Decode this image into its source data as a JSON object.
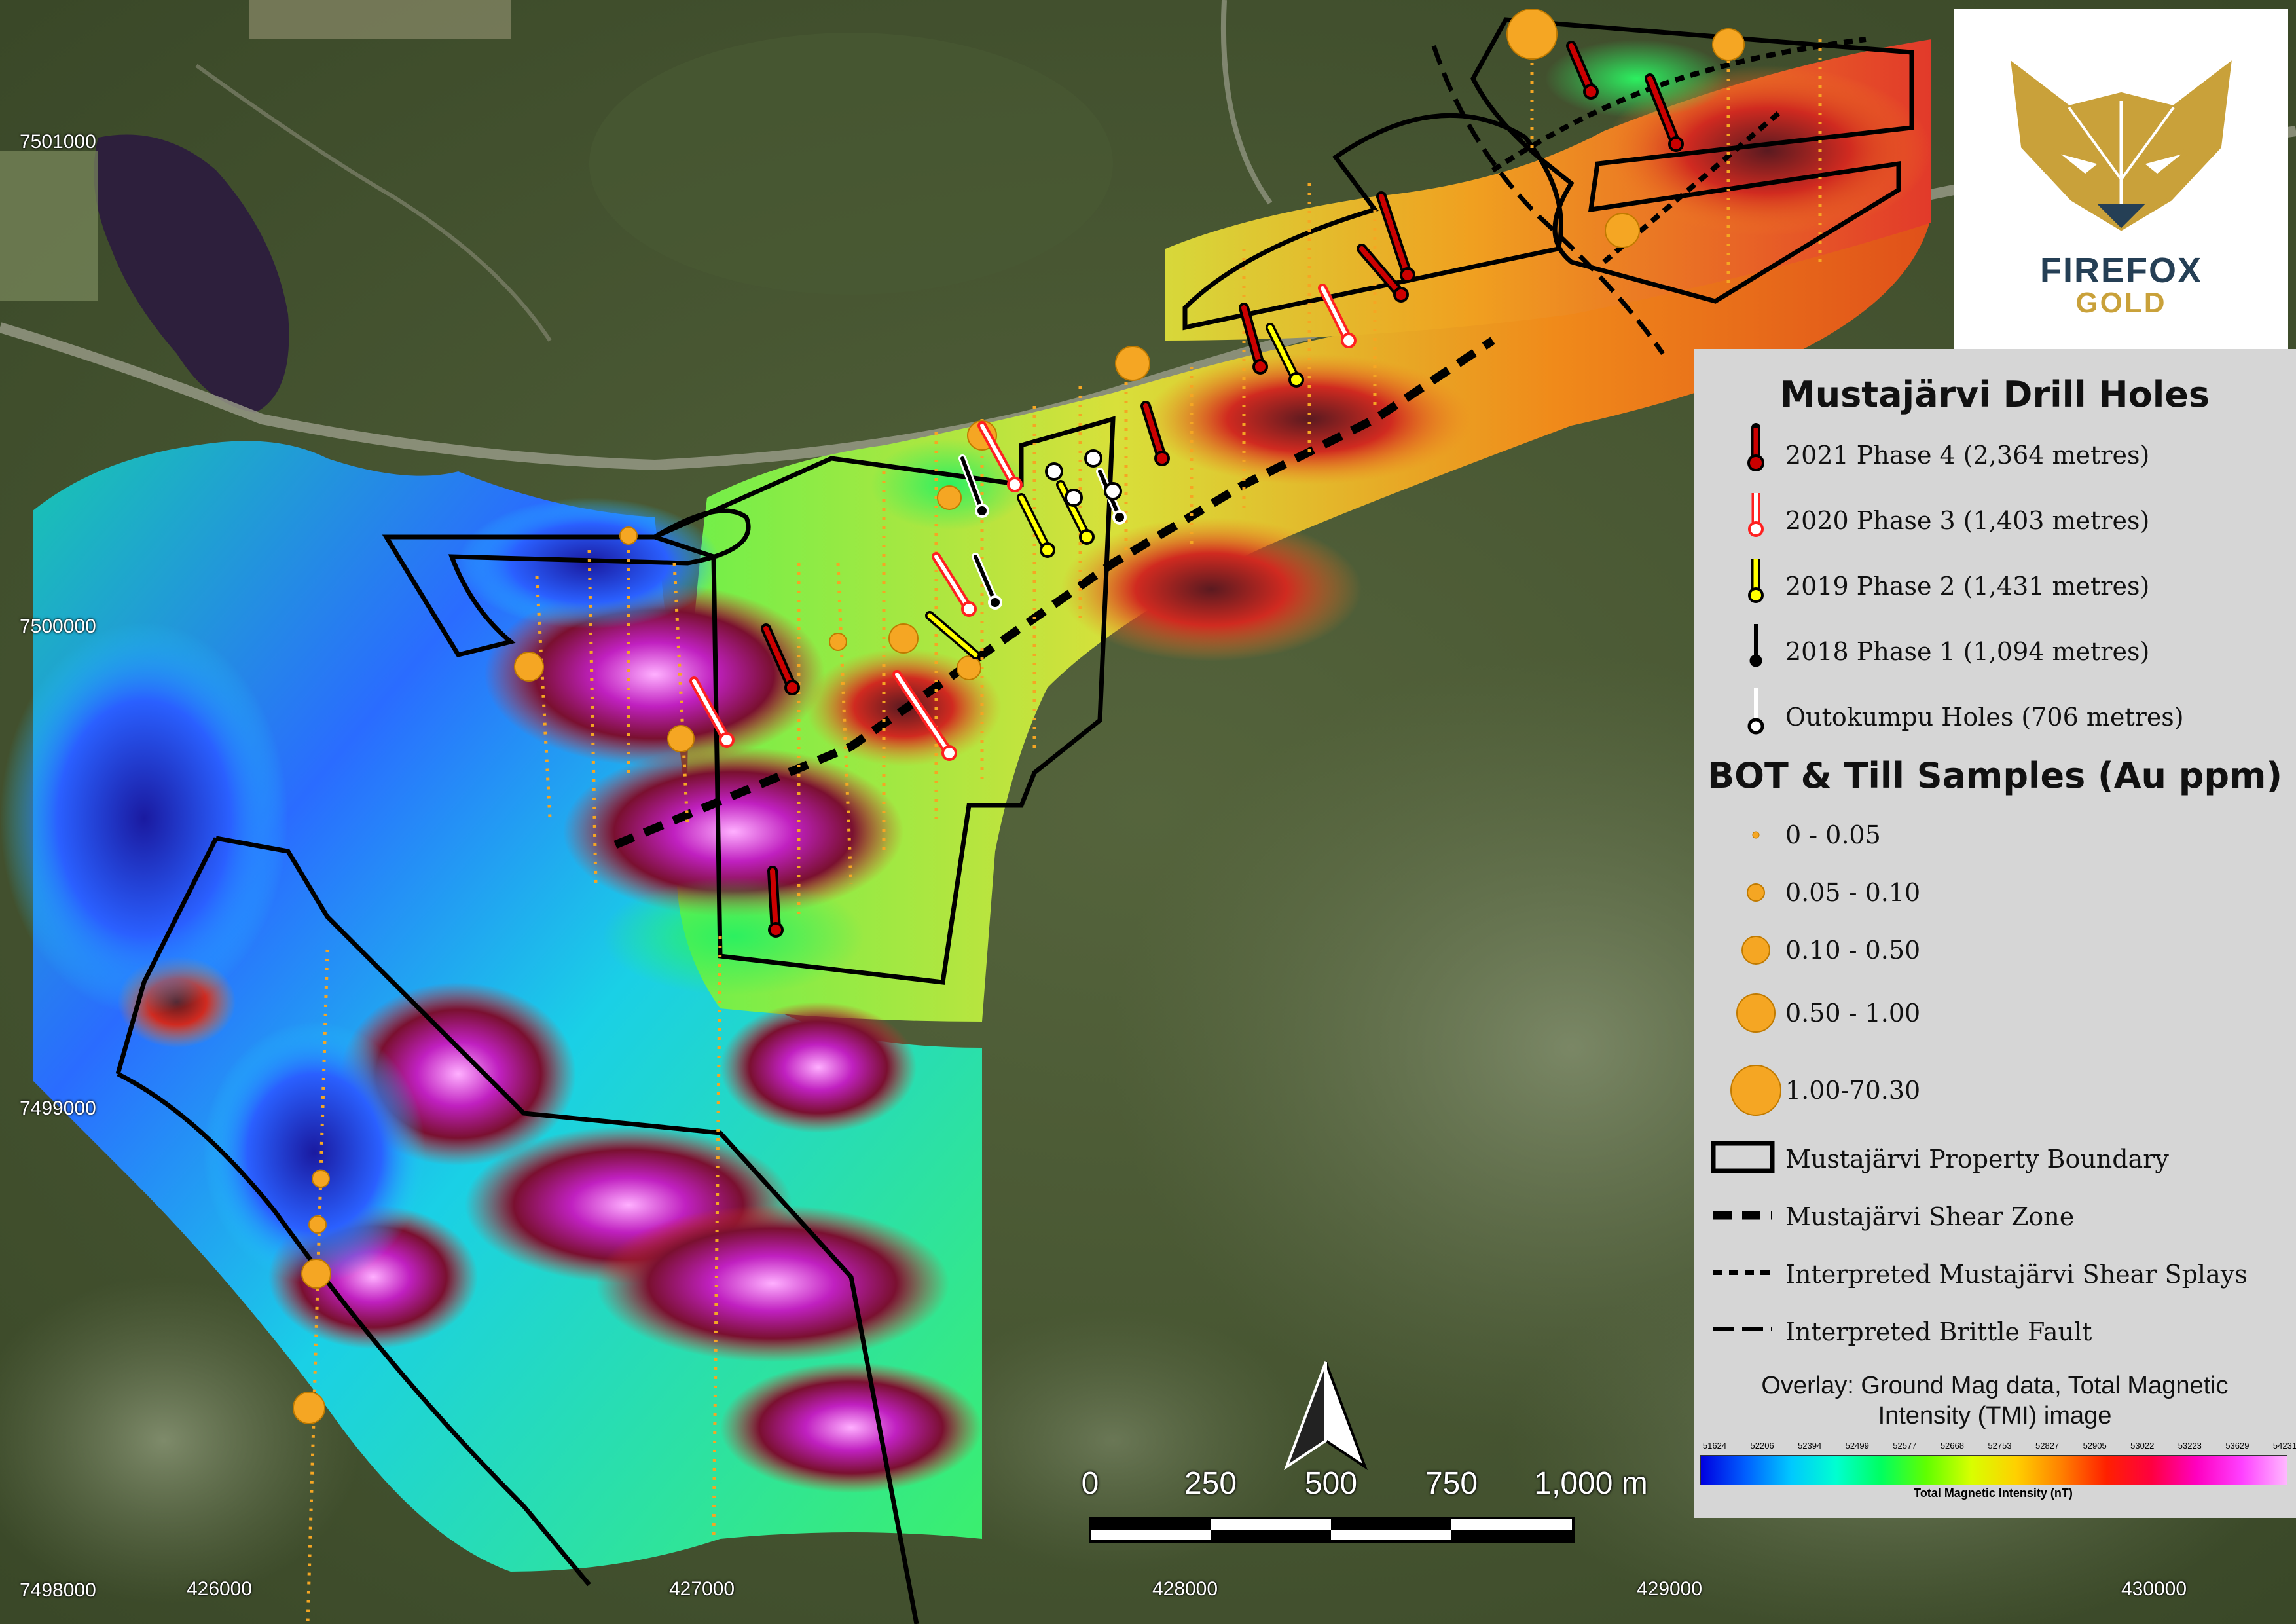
{
  "map": {
    "y_coordinates": [
      "7501000",
      "7500000",
      "7499000",
      "7498000"
    ],
    "x_coordinates": [
      "426000",
      "427000",
      "428000",
      "429000",
      "430000"
    ]
  },
  "logo": {
    "brand_line1": "FIREFOX",
    "brand_line2": "GOLD",
    "colors": {
      "gold": "#c9a13a",
      "navy": "#253f55"
    }
  },
  "legend": {
    "drill_title": "Mustajärvi Drill Holes",
    "drill_holes": [
      {
        "label": "2021 Phase 4 (2,364 metres)",
        "color": "#cc0000",
        "collar": "#cc0000"
      },
      {
        "label": "2020 Phase 3 (1,403 metres)",
        "color": "#ffffff",
        "collar": "#ff2020"
      },
      {
        "label": "2019 Phase 2 (1,431 metres)",
        "color": "#ffff00",
        "collar": "#ffff00"
      },
      {
        "label": "2018 Phase 1 (1,094 metres)",
        "color": "#000000",
        "collar": "#000000"
      },
      {
        "label": "Outokumpu Holes (706 metres)",
        "color": "#ffffff",
        "collar": "#ffffff"
      }
    ],
    "samples_title": "BOT & Till Samples (Au ppm)",
    "samples": [
      {
        "label": "0 - 0.05"
      },
      {
        "label": "0.05 - 0.10"
      },
      {
        "label": "0.10 - 0.50"
      },
      {
        "label": "0.50 - 1.00"
      },
      {
        "label": "1.00-70.30"
      }
    ],
    "sample_color": "#f5a623",
    "lines": [
      {
        "label": "Mustajärvi Property Boundary",
        "style": "box"
      },
      {
        "label": "Mustajärvi Shear Zone",
        "style": "thick-dash"
      },
      {
        "label": "Interpreted Mustajärvi Shear Splays",
        "style": "dash"
      },
      {
        "label": "Interpreted Brittle Fault",
        "style": "long-dash"
      }
    ],
    "overlay_line1": "Overlay: Ground Mag data, Total Magnetic",
    "overlay_line2": "Intensity (TMI) image",
    "colorbar_ticks": [
      "51624",
      "52206",
      "52394",
      "52499",
      "52577",
      "52668",
      "52753",
      "52827",
      "52905",
      "53022",
      "53223",
      "53629",
      "54231"
    ],
    "colorbar_label": "Total Magnetic Intensity (nT)"
  },
  "scale_bar": {
    "labels": [
      "0",
      "250",
      "500",
      "750",
      "1,000 m"
    ]
  }
}
